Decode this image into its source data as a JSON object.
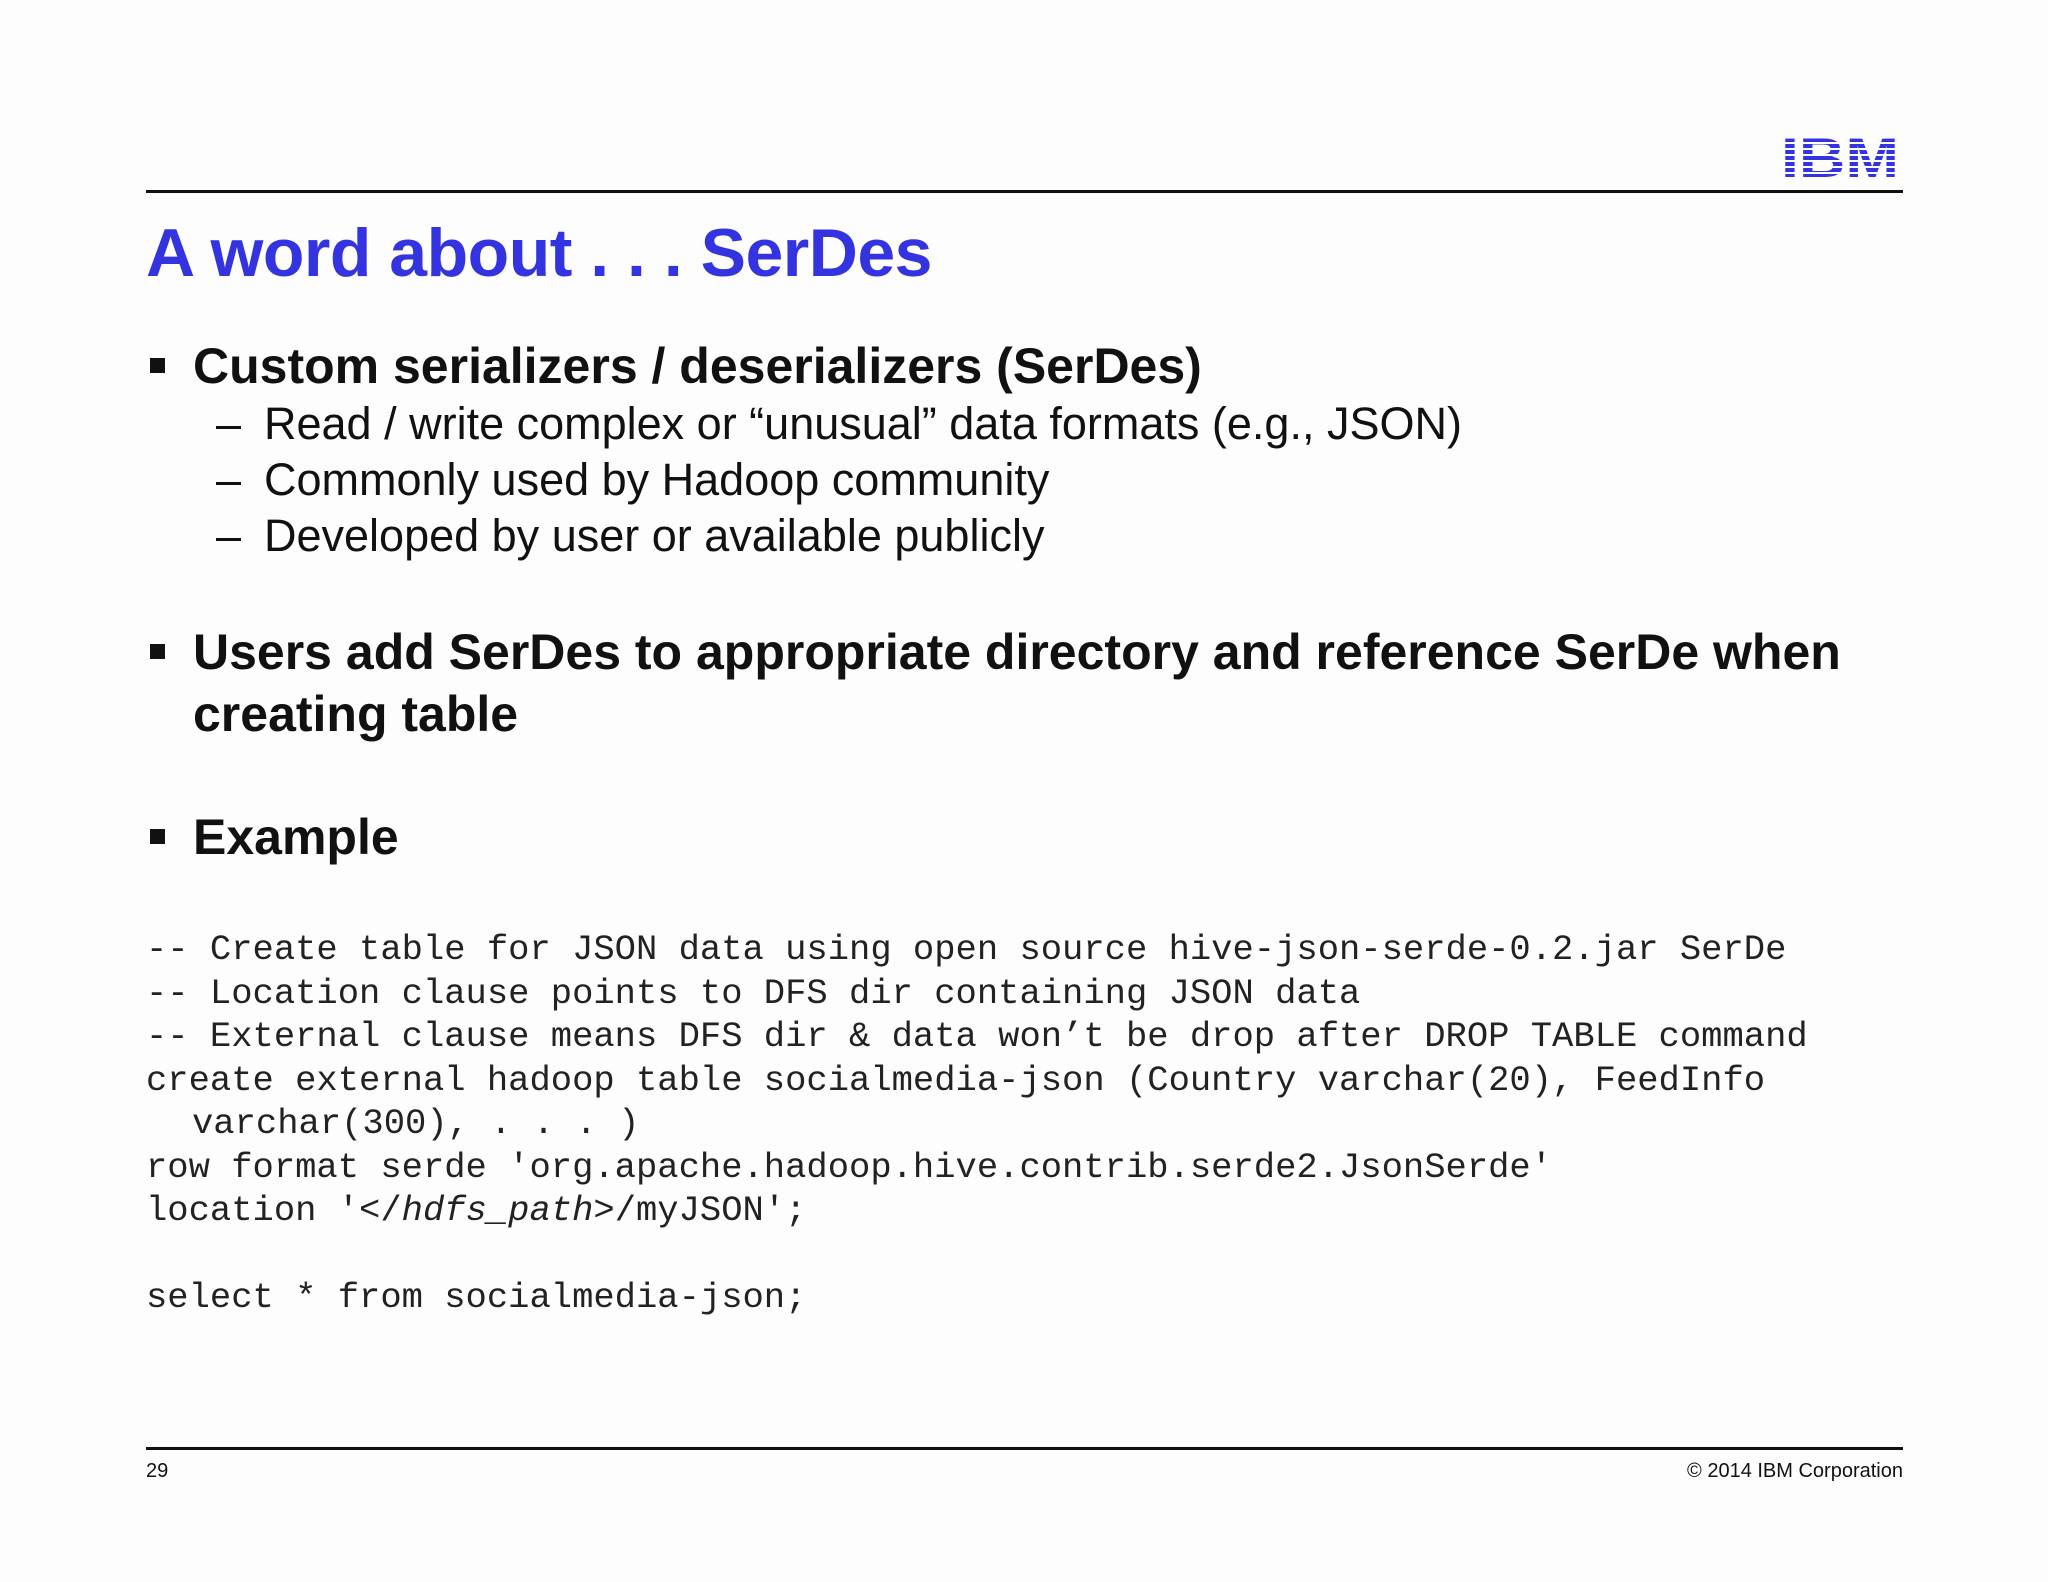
{
  "logo": {
    "text": "IBM",
    "color": "#3333e0"
  },
  "title": "A word about . . . SerDes",
  "bullets": [
    {
      "text": "Custom serializers / deserializers (SerDes)",
      "subs": [
        "Read / write complex or “unusual” data formats (e.g., JSON)",
        "Commonly used by Hadoop community",
        "Developed by user or available publicly"
      ]
    },
    {
      "text": "Users add SerDes to appropriate directory and reference SerDe when creating table",
      "subs": []
    },
    {
      "text": "Example",
      "subs": []
    }
  ],
  "sub_dash": "–",
  "code": {
    "line1": "-- Create table for JSON data using open source hive-json-serde-0.2.jar SerDe",
    "line2": "-- Location clause points to DFS dir containing JSON data",
    "line3": "-- External clause means DFS dir & data won’t be drop after DROP TABLE command",
    "line4": "create external hadoop table socialmedia-json (Country varchar(20), FeedInfo",
    "line5": "varchar(300), . . . )",
    "line6": "row format serde 'org.apache.hadoop.hive.contrib.serde2.JsonSerde'",
    "line7_pre": "location '</",
    "line7_italic": "hdfs_path",
    "line7_post": ">/myJSON';",
    "line8": "select * from socialmedia-json;"
  },
  "footer": {
    "page_number": "29",
    "copyright": "© 2014 IBM Corporation"
  },
  "colors": {
    "title": "#3333e0",
    "text": "#111111",
    "code": "#222222"
  }
}
